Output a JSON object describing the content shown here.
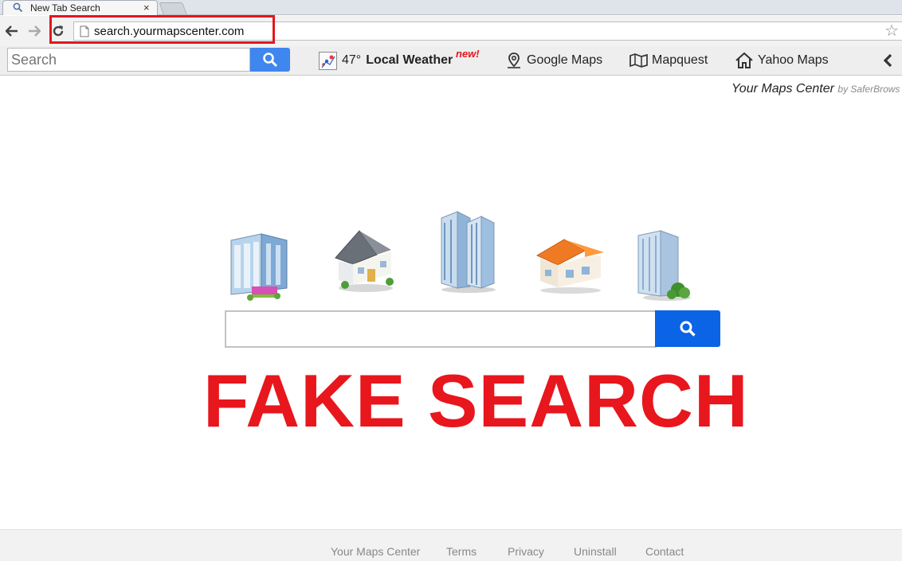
{
  "tab": {
    "title": "New Tab Search",
    "close": "×"
  },
  "omnibox": {
    "url": "search.yourmapscenter.com",
    "star": "☆"
  },
  "toolbar": {
    "search_placeholder": "Search",
    "weather_temp": "47°",
    "weather_label": "Local Weather",
    "weather_badge": "new!",
    "links": [
      "Google Maps",
      "Mapquest",
      "Yahoo Maps"
    ]
  },
  "brand": {
    "name": "Your Maps Center",
    "by": "by SaferBrows"
  },
  "stamp": "FAKE SEARCH",
  "footer": {
    "links": [
      "Your Maps Center",
      "Terms",
      "Privacy",
      "Uninstall",
      "Contact"
    ]
  },
  "colors": {
    "toolbar_search_button": "#3f86ee",
    "main_search_button": "#0b63e6",
    "stamp_red": "#e8161d",
    "highlight_red": "#e3161d"
  },
  "icons": [
    "search-icon",
    "close-icon",
    "back-arrow-icon",
    "forward-arrow-icon",
    "reload-icon",
    "page-icon",
    "star-icon",
    "weather-icon",
    "map-pin-icon",
    "map-icon",
    "home-icon",
    "chevron-left-icon"
  ]
}
